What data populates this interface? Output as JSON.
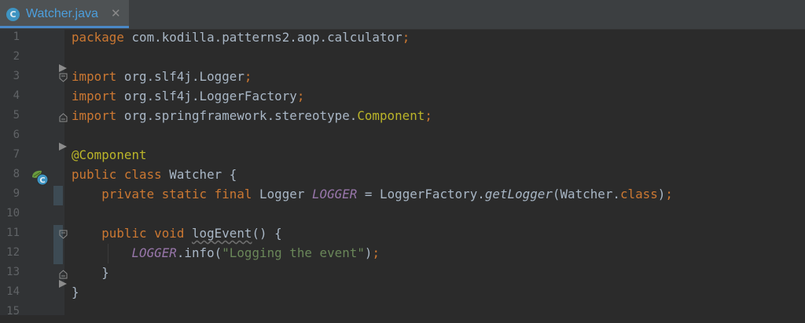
{
  "tab": {
    "title": "Watcher.java",
    "icon": "java-class-icon",
    "icon_letter": "C",
    "close": "✕"
  },
  "editor": {
    "line_numbers": [
      "1",
      "2",
      "3",
      "4",
      "5",
      "6",
      "7",
      "8",
      "9",
      "10",
      "11",
      "12",
      "13",
      "14",
      "15"
    ],
    "lines": [
      "package com.kodilla.patterns2.aop.calculator;",
      "",
      "import org.slf4j.Logger;",
      "import org.slf4j.LoggerFactory;",
      "import org.springframework.stereotype.Component;",
      "",
      "@Component",
      "public class Watcher {",
      "    private static final Logger LOGGER = LoggerFactory.getLogger(Watcher.class);",
      "",
      "    public void logEvent() {",
      "        LOGGER.info(\"Logging the event\");",
      "    }",
      "}",
      ""
    ]
  },
  "colors": {
    "background": "#2b2b2b",
    "keyword": "#cc7832",
    "string": "#6a8759",
    "annotation": "#bbb529",
    "field": "#9876aa",
    "text": "#a9b7c6"
  }
}
